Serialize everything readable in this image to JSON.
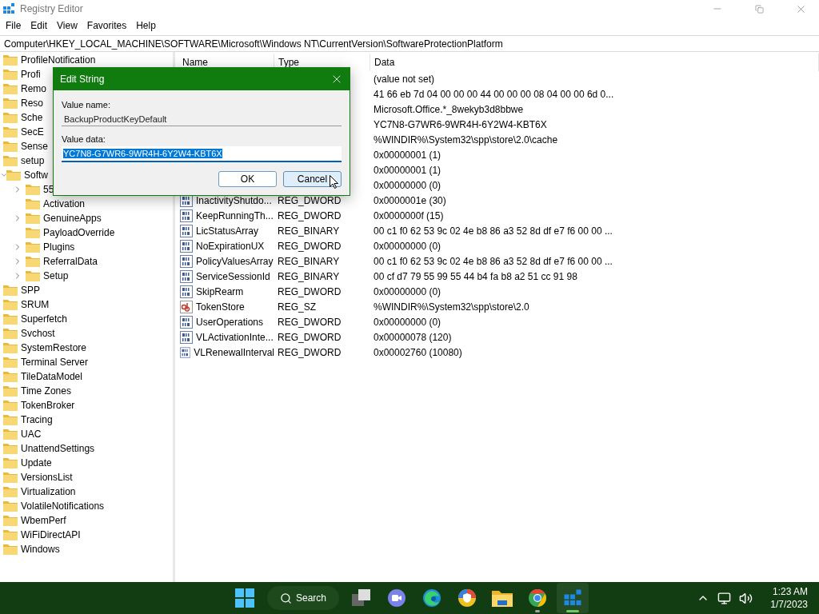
{
  "window": {
    "title": "Registry Editor"
  },
  "menu": [
    "File",
    "Edit",
    "View",
    "Favorites",
    "Help"
  ],
  "address": "Computer\\HKEY_LOCAL_MACHINE\\SOFTWARE\\Microsoft\\Windows NT\\CurrentVersion\\SoftwareProtectionPlatform",
  "tree": [
    {
      "label": "ProfileNotification",
      "expanded": false
    },
    {
      "label": "Profi",
      "expanded": false
    },
    {
      "label": "Remo",
      "expanded": false
    },
    {
      "label": "Reso",
      "expanded": false
    },
    {
      "label": "Sche",
      "expanded": false
    },
    {
      "label": "SecE",
      "expanded": false
    },
    {
      "label": "Sense",
      "expanded": false
    },
    {
      "label": "setup",
      "expanded": false
    },
    {
      "label": "Softw",
      "expanded": true,
      "children": [
        {
          "label": "55",
          "expandable": true
        },
        {
          "label": "Activation",
          "expandable": false
        },
        {
          "label": "GenuineApps",
          "expandable": true
        },
        {
          "label": "PayloadOverride",
          "expandable": false
        },
        {
          "label": "Plugins",
          "expandable": true
        },
        {
          "label": "ReferralData",
          "expandable": true
        },
        {
          "label": "Setup",
          "expandable": true
        }
      ]
    },
    {
      "label": "SPP",
      "expanded": false
    },
    {
      "label": "SRUM",
      "expanded": false
    },
    {
      "label": "Superfetch",
      "expanded": false
    },
    {
      "label": "Svchost",
      "expanded": false
    },
    {
      "label": "SystemRestore",
      "expanded": false
    },
    {
      "label": "Terminal Server",
      "expanded": false
    },
    {
      "label": "TileDataModel",
      "expanded": false
    },
    {
      "label": "Time Zones",
      "expanded": false
    },
    {
      "label": "TokenBroker",
      "expanded": false
    },
    {
      "label": "Tracing",
      "expanded": false
    },
    {
      "label": "UAC",
      "expanded": false
    },
    {
      "label": "UnattendSettings",
      "expanded": false
    },
    {
      "label": "Update",
      "expanded": false
    },
    {
      "label": "VersionsList",
      "expanded": false
    },
    {
      "label": "Virtualization",
      "expanded": false
    },
    {
      "label": "VolatileNotifications",
      "expanded": false
    },
    {
      "label": "WbemPerf",
      "expanded": false
    },
    {
      "label": "WiFiDirectAPI",
      "expanded": false
    },
    {
      "label": "Windows",
      "expanded": false
    }
  ],
  "table": {
    "columns": [
      "Name",
      "Type",
      "Data"
    ],
    "rows": [
      {
        "data": "(value not set)"
      },
      {
        "data": "41 66 eb 7d 04 00 00 00 44 00 00 00 08 04 00 00 6d 0..."
      },
      {
        "data": "Microsoft.Office.*_8wekyb3d8bbwe"
      },
      {
        "data": "YC7N8-G7WR6-9WR4H-6Y2W4-KBT6X"
      },
      {
        "data": "%WINDIR%\\System32\\spp\\store\\2.0\\cache"
      },
      {
        "data": "0x00000001 (1)"
      },
      {
        "data": "0x00000001 (1)"
      },
      {
        "data": "0x00000000 (0)"
      },
      {
        "kind": "binary",
        "name": "InactivityShutdo...",
        "type": "REG_DWORD",
        "data": "0x0000001e (30)"
      },
      {
        "kind": "binary",
        "name": "KeepRunningTh...",
        "type": "REG_DWORD",
        "data": "0x0000000f (15)"
      },
      {
        "kind": "binary",
        "name": "LicStatusArray",
        "type": "REG_BINARY",
        "data": "00 c1 f0 62 53 9c 02 4e b8 86 a3 52 8d df e7 f6 00 00 ..."
      },
      {
        "kind": "binary",
        "name": "NoExpirationUX",
        "type": "REG_DWORD",
        "data": "0x00000000 (0)"
      },
      {
        "kind": "binary",
        "name": "PolicyValuesArray",
        "type": "REG_BINARY",
        "data": "00 c1 f0 62 53 9c 02 4e b8 86 a3 52 8d df e7 f6 00 00 ..."
      },
      {
        "kind": "binary",
        "name": "ServiceSessionId",
        "type": "REG_BINARY",
        "data": "00 cf d7 79 55 99 55 44 b4 fa b8 a2 51 cc 91 98"
      },
      {
        "kind": "binary",
        "name": "SkipRearm",
        "type": "REG_DWORD",
        "data": "0x00000000 (0)"
      },
      {
        "kind": "string",
        "name": "TokenStore",
        "type": "REG_SZ",
        "data": "%WINDIR%\\System32\\spp\\store\\2.0"
      },
      {
        "kind": "binary",
        "name": "UserOperations",
        "type": "REG_DWORD",
        "data": "0x00000000 (0)"
      },
      {
        "kind": "binary",
        "name": "VLActivationInte...",
        "type": "REG_DWORD",
        "data": "0x00000078 (120)"
      },
      {
        "kind": "binary",
        "name": "VLRenewalInterval",
        "type": "REG_DWORD",
        "data": "0x00002760 (10080)"
      }
    ]
  },
  "dialog": {
    "title": "Edit String",
    "name_label": "Value name:",
    "name_value": "BackupProductKeyDefault",
    "data_label": "Value data:",
    "data_value": "YC7N8-G7WR6-9WR4H-6Y2W4-KBT6X",
    "buttons": [
      "OK",
      "Cancel"
    ]
  },
  "taskbar": {
    "apps": [
      {
        "kind": "start",
        "running": false,
        "active": false
      },
      {
        "kind": "search",
        "label": "Search"
      },
      {
        "kind": "taskview",
        "running": false,
        "active": false
      },
      {
        "kind": "chat",
        "running": false,
        "active": false
      },
      {
        "kind": "edge",
        "running": false,
        "active": false
      },
      {
        "kind": "shield",
        "running": false,
        "active": false
      },
      {
        "kind": "explorer",
        "running": false,
        "active": false
      },
      {
        "kind": "chrome",
        "running": true,
        "active": false
      },
      {
        "kind": "regedit",
        "running": true,
        "active": true
      }
    ],
    "time": "1:23 AM",
    "date": "1/7/2023"
  }
}
